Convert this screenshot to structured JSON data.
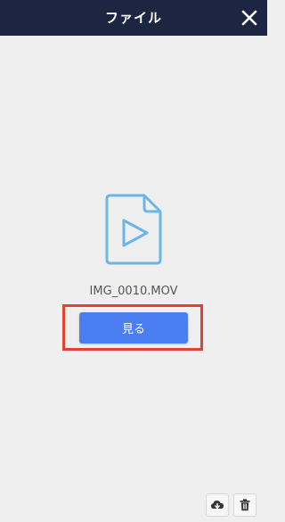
{
  "header": {
    "title": "ファイル",
    "close_icon": "close-icon"
  },
  "file": {
    "icon": "video-file-icon",
    "name": "IMG_0010.MOV"
  },
  "actions": {
    "view_label": "見る"
  },
  "toolbar": {
    "download_icon": "cloud-download-icon",
    "delete_icon": "trash-icon"
  },
  "colors": {
    "header_bg": "#1c2541",
    "background": "#efefef",
    "button": "#4b7ef1",
    "highlight": "#e1442e",
    "file_icon": "#6bb6e8"
  }
}
